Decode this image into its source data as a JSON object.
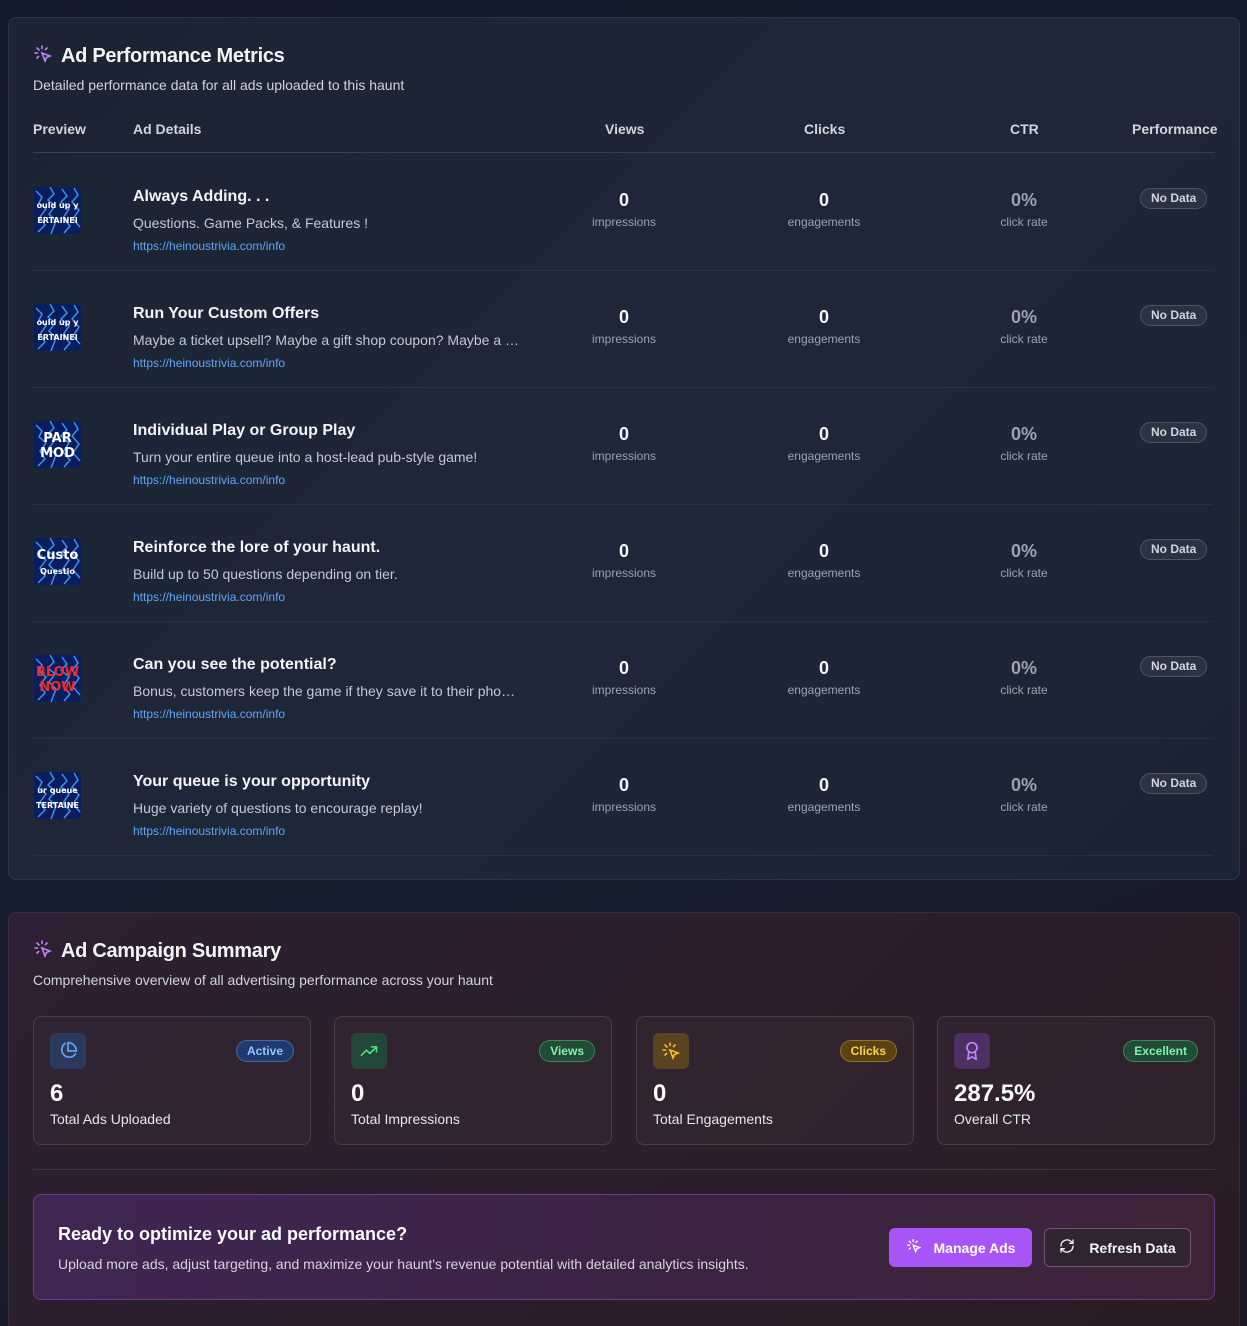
{
  "metrics": {
    "title": "Ad Performance Metrics",
    "subtitle": "Detailed performance data for all ads uploaded to this haunt",
    "columns": {
      "preview": "Preview",
      "details": "Ad Details",
      "views": "Views",
      "clicks": "Clicks",
      "ctr": "CTR",
      "performance": "Performance"
    },
    "rows": [
      {
        "title": "Always Adding. . .",
        "desc": "Questions. Game Packs, & Features !",
        "link": "https://heinoustrivia.com/info",
        "views": "0",
        "views_unit": "impressions",
        "clicks": "0",
        "clicks_unit": "engagements",
        "ctr": "0%",
        "ctr_unit": "click rate",
        "badge": "No Data",
        "thumb_text": [
          "ould up y",
          "ERTAINEI"
        ],
        "thumb_color": "#ffffff"
      },
      {
        "title": "Run Your Custom Offers",
        "desc": "Maybe a ticket upsell? Maybe a gift shop coupon? Maybe a r…",
        "link": "https://heinoustrivia.com/info",
        "views": "0",
        "views_unit": "impressions",
        "clicks": "0",
        "clicks_unit": "engagements",
        "ctr": "0%",
        "ctr_unit": "click rate",
        "badge": "No Data",
        "thumb_text": [
          "ould up y",
          "ERTAINEI"
        ],
        "thumb_color": "#ffffff"
      },
      {
        "title": "Individual Play or Group Play",
        "desc": "Turn your entire queue into a host-lead pub-style game!",
        "link": "https://heinoustrivia.com/info",
        "views": "0",
        "views_unit": "impressions",
        "clicks": "0",
        "clicks_unit": "engagements",
        "ctr": "0%",
        "ctr_unit": "click rate",
        "badge": "No Data",
        "thumb_text": [
          "PAR",
          "MOD"
        ],
        "thumb_color": "#ffffff"
      },
      {
        "title": "Reinforce the lore of your haunt.",
        "desc": "Build up to 50 questions depending on tier.",
        "link": "https://heinoustrivia.com/info",
        "views": "0",
        "views_unit": "impressions",
        "clicks": "0",
        "clicks_unit": "engagements",
        "ctr": "0%",
        "ctr_unit": "click rate",
        "badge": "No Data",
        "thumb_text": [
          "Custo",
          "Questio"
        ],
        "thumb_color": "#ffffff"
      },
      {
        "title": "Can you see the potential?",
        "desc": "Bonus, customers keep the game if they save it to their pho…",
        "link": "https://heinoustrivia.com/info",
        "views": "0",
        "views_unit": "impressions",
        "clicks": "0",
        "clicks_unit": "engagements",
        "ctr": "0%",
        "ctr_unit": "click rate",
        "badge": "No Data",
        "thumb_text": [
          "BLOW",
          "NOW"
        ],
        "thumb_color": "#ef2b2b"
      },
      {
        "title": "Your queue is your opportunity",
        "desc": "Huge variety of questions to encourage replay!",
        "link": "https://heinoustrivia.com/info",
        "views": "0",
        "views_unit": "impressions",
        "clicks": "0",
        "clicks_unit": "engagements",
        "ctr": "0%",
        "ctr_unit": "click rate",
        "badge": "No Data",
        "thumb_text": [
          "ur queue",
          "TERTAINE"
        ],
        "thumb_color": "#ffffff"
      }
    ]
  },
  "summary": {
    "title": "Ad Campaign Summary",
    "subtitle": "Comprehensive overview of all advertising performance across your haunt",
    "stats": [
      {
        "value": "6",
        "label": "Total Ads Uploaded",
        "pill": "Active",
        "icon": "pie-chart-icon",
        "pill_bg": "#1e3a6e",
        "pill_fg": "#93c5fd",
        "icon_bg": "#2b3a5c",
        "icon_fg": "#60a5fa"
      },
      {
        "value": "0",
        "label": "Total Impressions",
        "pill": "Views",
        "icon": "trending-up-icon",
        "pill_bg": "#1f4d35",
        "pill_fg": "#86efac",
        "icon_bg": "#24463a",
        "icon_fg": "#4ade80"
      },
      {
        "value": "0",
        "label": "Total Engagements",
        "pill": "Clicks",
        "icon": "pointer-click-icon",
        "pill_bg": "#5c4212",
        "pill_fg": "#fcd34d",
        "icon_bg": "#5a4322",
        "icon_fg": "#fbbf24"
      },
      {
        "value": "287.5%",
        "label": "Overall CTR",
        "pill": "Excellent",
        "icon": "award-icon",
        "pill_bg": "#1f4d35",
        "pill_fg": "#86efac",
        "icon_bg": "#4a3162",
        "icon_fg": "#c084fc"
      }
    ],
    "cta": {
      "heading": "Ready to optimize your ad performance?",
      "text": "Upload more ads, adjust targeting, and maximize your haunt's revenue potential with detailed analytics insights.",
      "manage_label": "Manage Ads",
      "refresh_label": "Refresh Data"
    }
  },
  "colors": {
    "accent": "#a855f7",
    "link": "#60a5fa"
  }
}
